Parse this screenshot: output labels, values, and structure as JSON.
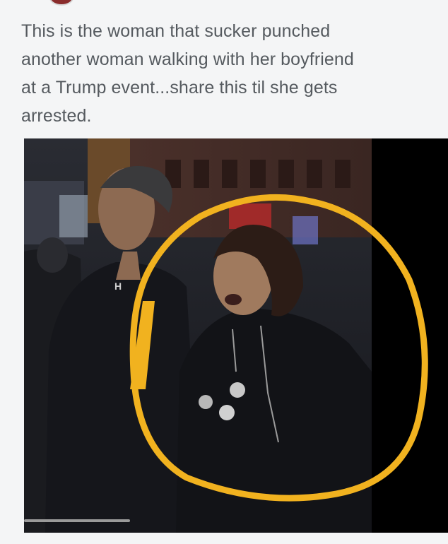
{
  "post": {
    "text_lines": [
      "This is the woman that sucker punched",
      "another woman walking with her boyfriend",
      "at a Trump event...share this til she gets",
      "arrested."
    ]
  },
  "media": {
    "type": "photo",
    "annotation_color": "#f1b21f",
    "apparel_logo": "H"
  },
  "video": {
    "progress": 0.25
  }
}
